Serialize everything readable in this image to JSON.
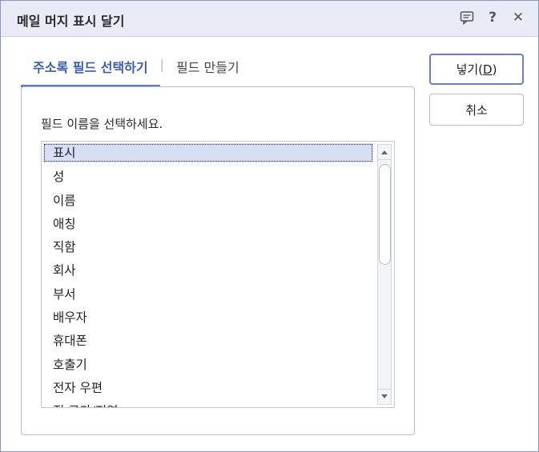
{
  "dialog": {
    "title": "메일 머지 표시 달기",
    "icons": [
      "comment-icon",
      "help-icon",
      "close-icon"
    ],
    "help_glyph": "?",
    "close_glyph": "✕"
  },
  "tabs": [
    {
      "label": "주소록 필드 선택하기",
      "active": true
    },
    {
      "label": "필드 만들기",
      "active": false
    }
  ],
  "tab_separator": "|",
  "panel": {
    "prompt": "필드 이름을 선택하세요.",
    "fields": [
      "표시",
      "성",
      "이름",
      "애칭",
      "직함",
      "회사",
      "부서",
      "배우자",
      "휴대폰",
      "호출기",
      "전자 우편",
      "집 국가/지역"
    ],
    "selected_index": 0
  },
  "buttons": {
    "insert_label_prefix": "넣기(",
    "insert_label_key": "D",
    "insert_label_suffix": ")",
    "cancel_label": "취소"
  },
  "colors": {
    "accent": "#3a5ea8",
    "title_bar": "#e9ecf7",
    "selection": "#d7def6"
  }
}
